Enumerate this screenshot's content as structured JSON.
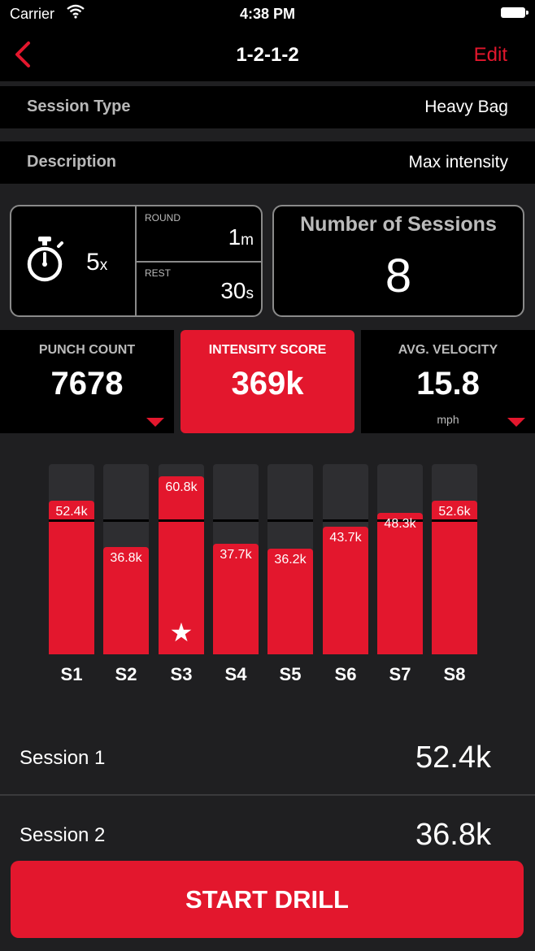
{
  "status": {
    "carrier": "Carrier",
    "time": "4:38 PM"
  },
  "nav": {
    "title": "1-2-1-2",
    "edit": "Edit"
  },
  "session_type": {
    "label": "Session Type",
    "value": "Heavy Bag"
  },
  "description": {
    "label": "Description",
    "value": "Max intensity"
  },
  "timer": {
    "rounds": "5",
    "rounds_suffix": "x",
    "round_label": "ROUND",
    "round_value": "1",
    "round_unit": "m",
    "rest_label": "REST",
    "rest_value": "30",
    "rest_unit": "s"
  },
  "sessions": {
    "label": "Number of Sessions",
    "value": "8"
  },
  "stats": {
    "punch": {
      "label": "PUNCH COUNT",
      "value": "7678"
    },
    "intensity": {
      "label": "INTENSITY SCORE",
      "value": "369k"
    },
    "velocity": {
      "label": "AVG. VELOCITY",
      "value": "15.8",
      "unit": "mph"
    }
  },
  "chart_data": {
    "type": "bar",
    "categories": [
      "S1",
      "S2",
      "S3",
      "S4",
      "S5",
      "S6",
      "S7",
      "S8"
    ],
    "values": [
      52.4,
      36.8,
      60.8,
      37.7,
      36.2,
      43.7,
      48.3,
      52.6
    ],
    "labels": [
      "52.4k",
      "36.8k",
      "60.8k",
      "37.7k",
      "36.2k",
      "43.7k",
      "48.3k",
      "52.6k"
    ],
    "best_index": 2,
    "average": 46.1,
    "ylim": [
      0,
      65
    ]
  },
  "list": [
    {
      "label": "Session 1",
      "value": "52.4k"
    },
    {
      "label": "Session 2",
      "value": "36.8k"
    }
  ],
  "start_button": "START DRILL",
  "colors": {
    "accent": "#e3172d",
    "background": "#1f1f21",
    "panel": "#000000"
  }
}
